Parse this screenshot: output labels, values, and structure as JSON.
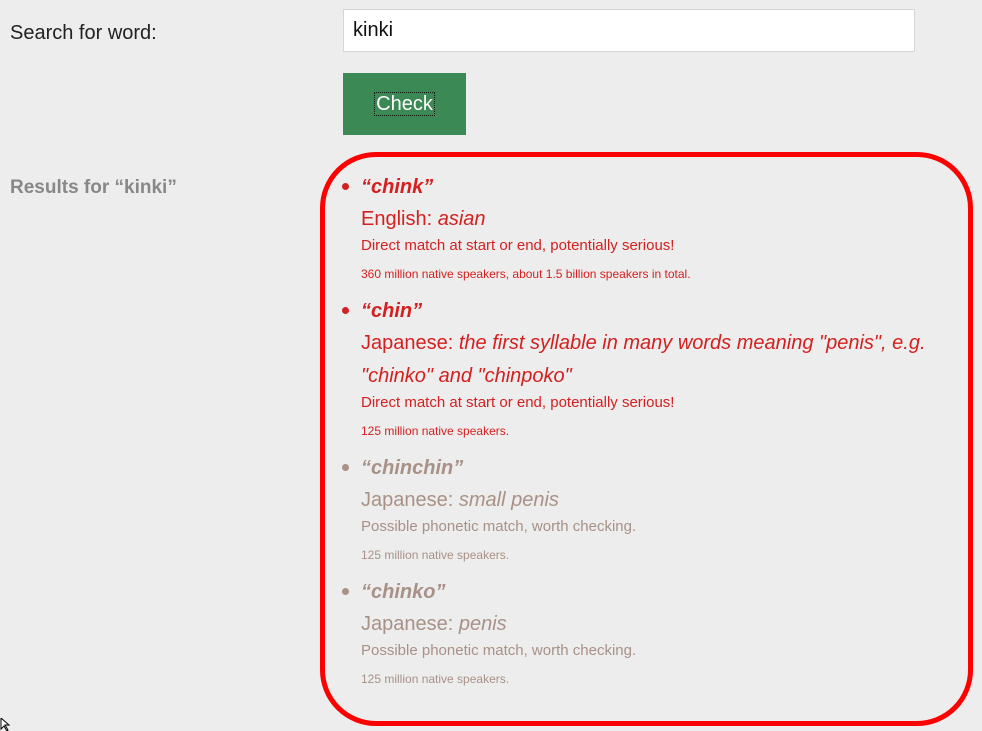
{
  "search": {
    "label": "Search for word:",
    "value": "kinki",
    "button_label": "Check"
  },
  "results": {
    "heading": "Results for “kinki”",
    "items": [
      {
        "word": "“chink”",
        "language": "English: ",
        "meaning": "asian",
        "note": "Direct match at start or end, potentially serious!",
        "speakers": "360 million native speakers, about 1.5 billion speakers in total.",
        "severity": "serious"
      },
      {
        "word": "“chin”",
        "language": "Japanese: ",
        "meaning": "the first syllable in many words meaning \"penis\", e.g. \"chinko\" and \"chinpoko\"",
        "note": "Direct match at start or end, potentially serious!",
        "speakers": "125 million native speakers.",
        "severity": "serious"
      },
      {
        "word": "“chinchin”",
        "language": "Japanese: ",
        "meaning": "small penis",
        "note": "Possible phonetic match, worth checking.",
        "speakers": "125 million native speakers.",
        "severity": "phonetic"
      },
      {
        "word": "“chinko”",
        "language": "Japanese: ",
        "meaning": "penis",
        "note": "Possible phonetic match, worth checking.",
        "speakers": "125 million native speakers.",
        "severity": "phonetic"
      }
    ]
  },
  "colors": {
    "serious": "#d42020",
    "phonetic": "#a89186",
    "button": "#3b8a55",
    "highlight": "#ff0000"
  }
}
